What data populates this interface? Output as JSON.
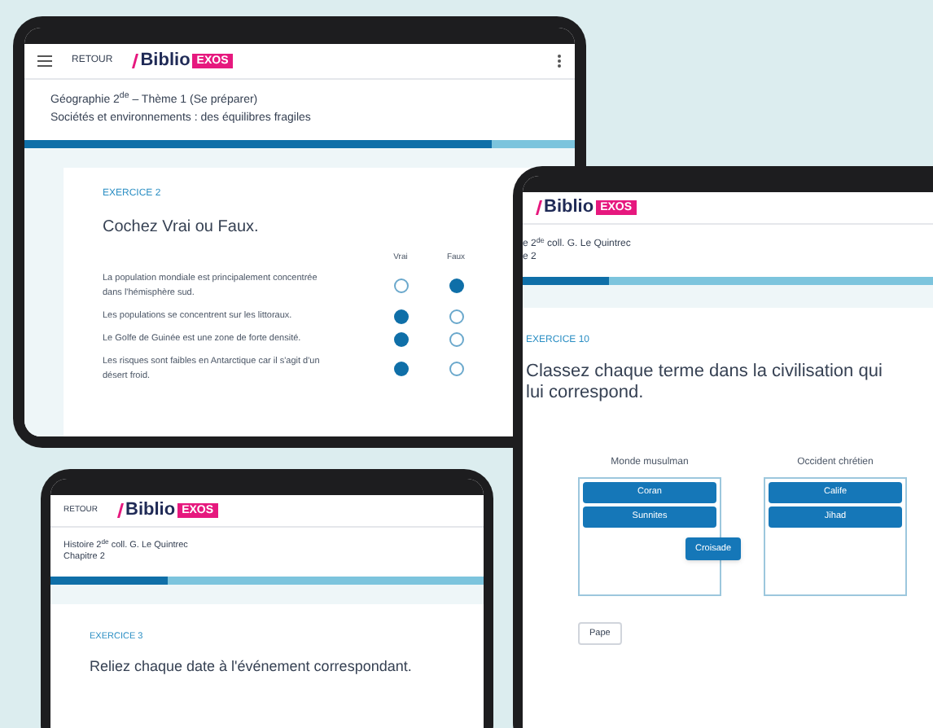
{
  "geo_tablet": {
    "back": "RETOUR",
    "logo": "Biblio",
    "logo_badge": "EXOS",
    "title": "Géographie 2$^{de}$ – Thème 1 (Se préparer)",
    "subtitle": "Sociétés et environnements : des équilibres fragiles",
    "progress": {
      "level": 0.85
    },
    "exercise_label": "EXERCICE 2",
    "instruction": "Cochez Vrai ou Faux.",
    "columns": [
      "Vrai",
      "Faux"
    ],
    "statements": [
      {
        "text": "La population mondiale est principalement concentrée dans l'hémisphère sud.",
        "options": [
          {
            "selected": false
          },
          {
            "selected": true
          }
        ]
      },
      {
        "text": "Les populations se concentrent sur les littoraux.",
        "options": [
          {
            "selected": true
          },
          {
            "selected": false
          }
        ]
      },
      {
        "text": "Le Golfe de Guinée est une zone de forte densité.",
        "options": [
          {
            "selected": true
          },
          {
            "selected": false
          }
        ]
      },
      {
        "text": "Les risques sont faibles en Antarctique car il s'agit d'un désert froid.",
        "options": [
          {
            "selected": true
          },
          {
            "selected": false
          }
        ]
      }
    ]
  },
  "right_tablet": {
    "logo": "Biblio",
    "logo_badge": "EXOS",
    "title_lines": [
      "e 2$^{de}$ coll. G. Le Quintrec",
      "e 2"
    ],
    "progress": {
      "level": 0.2
    },
    "exercise_label": "EXERCICE 10",
    "instruction": "Classez chaque terme dans la civilisation qui lui correspond.",
    "groups": [
      {
        "heading": "Monde musulman",
        "items": [
          "Coran",
          "Sunnites"
        ]
      },
      {
        "heading": "Occident chrétien",
        "items": [
          "Calife",
          "Jihad"
        ]
      }
    ],
    "dragged_item": "Croisade",
    "pool_items": [
      "Pape"
    ]
  },
  "bottom_tablet": {
    "back": "RETOUR",
    "logo": "Biblio",
    "logo_badge": "EXOS",
    "title_lines": [
      "Histoire 2$^{de}$ coll. G. Le Quintrec",
      "Chapitre 2"
    ],
    "progress": {
      "level": 0.27
    },
    "exercise_label": "EXERCICE 3",
    "instruction": "Reliez chaque date à l'événement correspondant."
  }
}
